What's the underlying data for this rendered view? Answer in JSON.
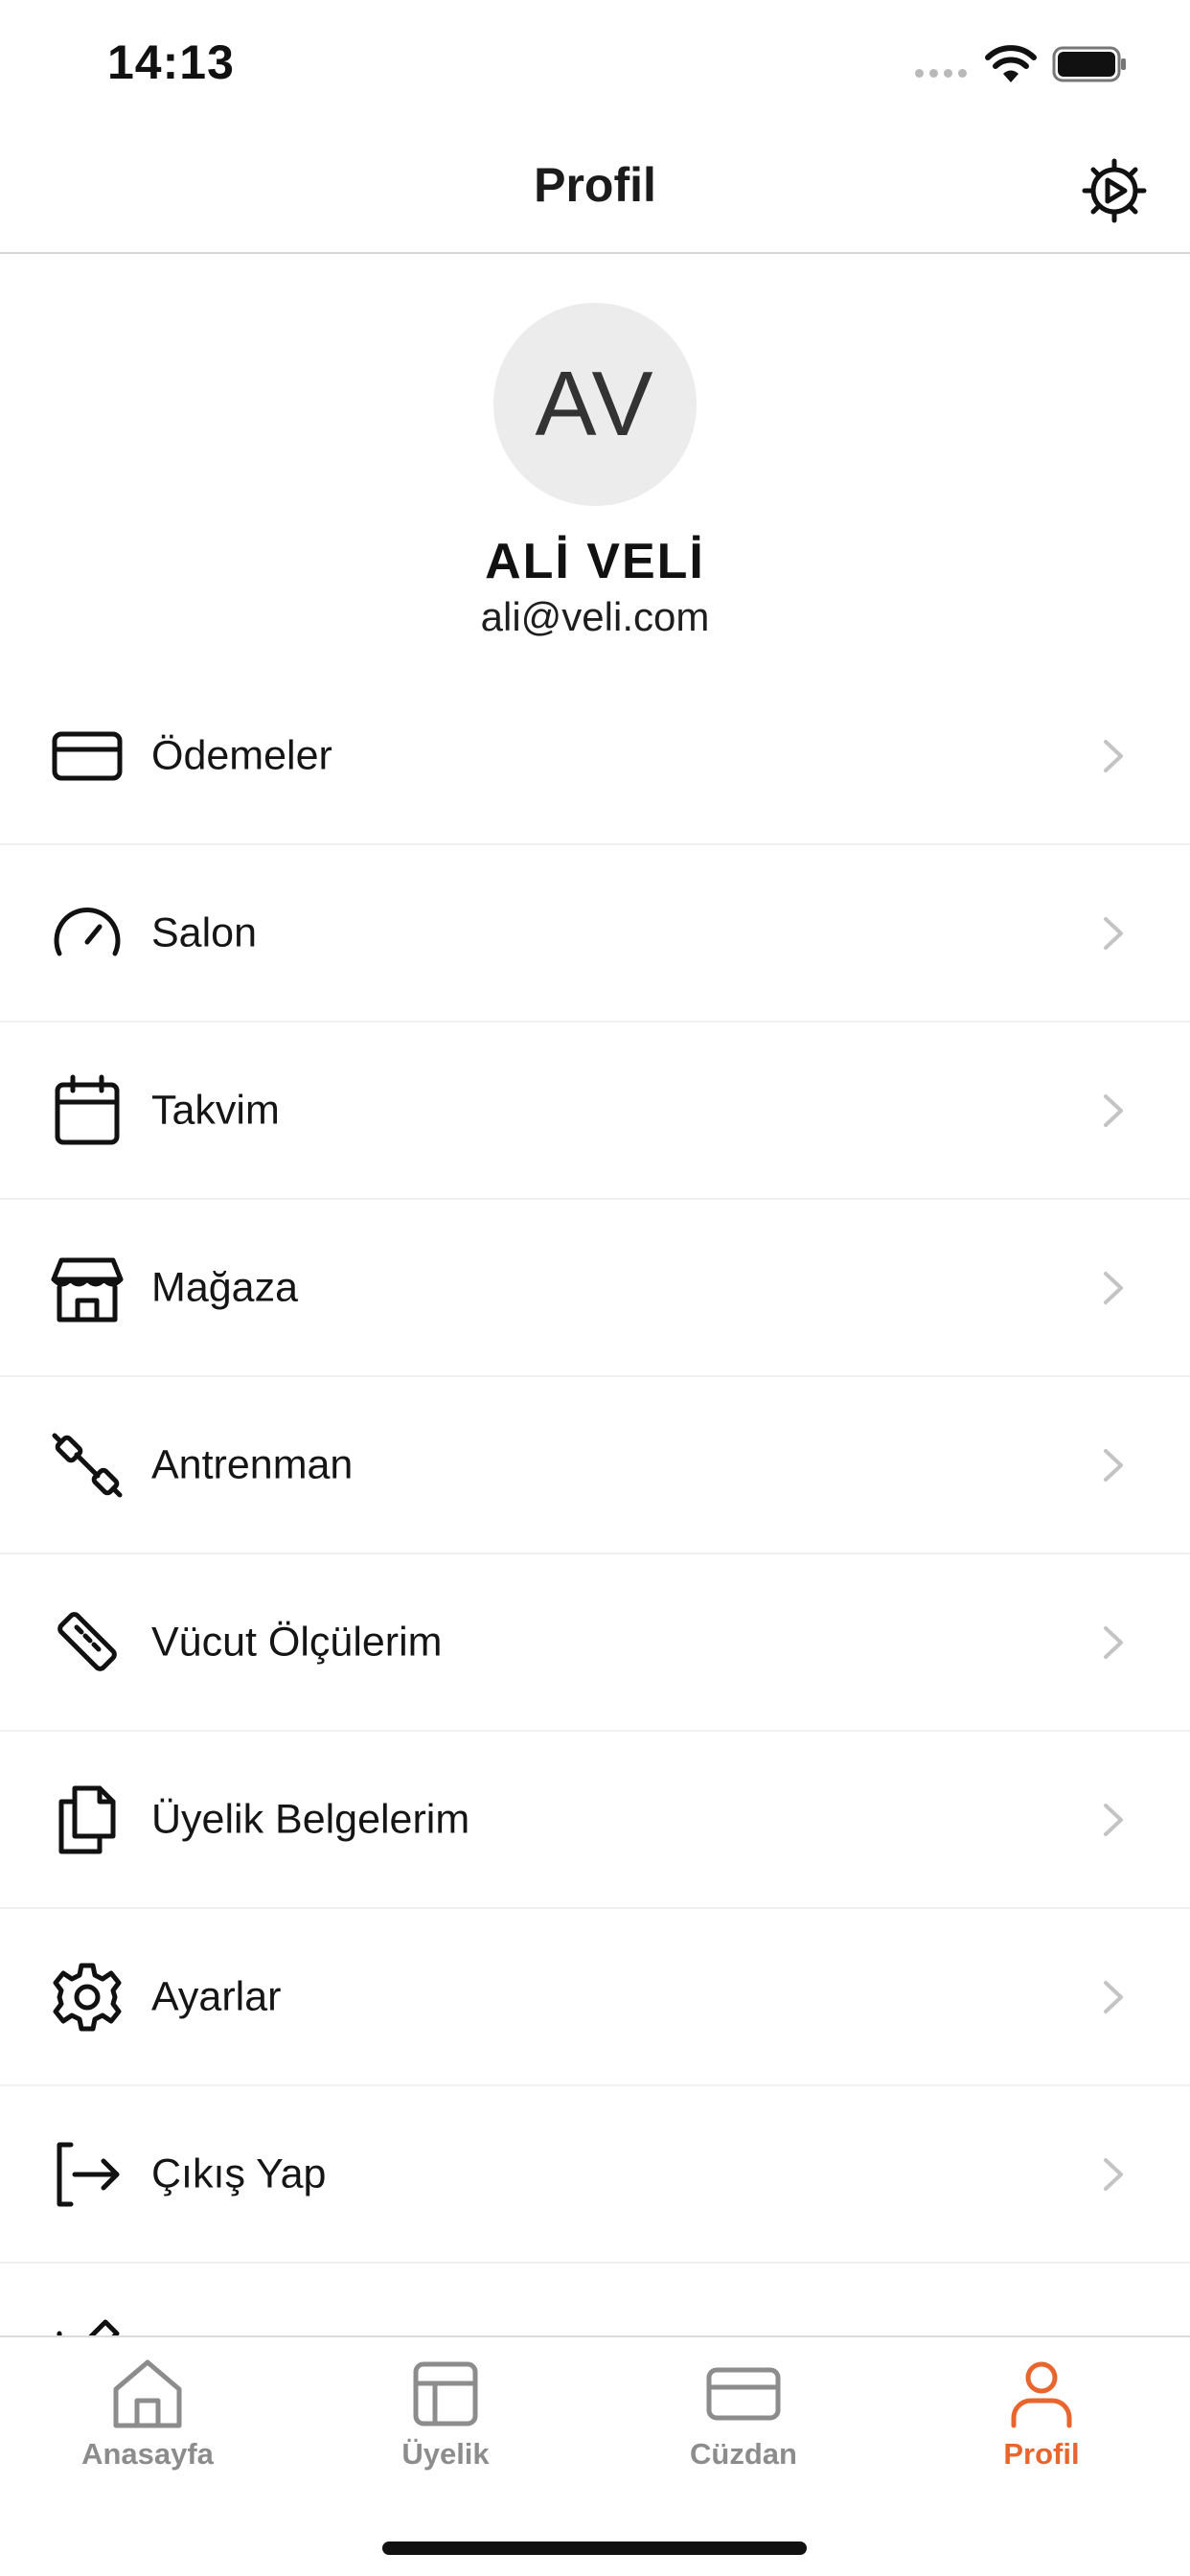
{
  "status_bar": {
    "time": "14:13"
  },
  "header": {
    "title": "Profil",
    "settings_icon": "gear-icon"
  },
  "profile": {
    "initials": "AV",
    "name": "ALİ VELİ",
    "email": "ali@veli.com"
  },
  "menu": {
    "items": [
      {
        "label": "Ödemeler",
        "icon": "credit-card-icon"
      },
      {
        "label": "Salon",
        "icon": "gauge-icon"
      },
      {
        "label": "Takvim",
        "icon": "calendar-icon"
      },
      {
        "label": "Mağaza",
        "icon": "store-icon"
      },
      {
        "label": "Antrenman",
        "icon": "dumbbell-icon"
      },
      {
        "label": "Vücut Ölçülerim",
        "icon": "ruler-icon"
      },
      {
        "label": "Üyelik Belgelerim",
        "icon": "documents-icon"
      },
      {
        "label": "Ayarlar",
        "icon": "gear-icon"
      },
      {
        "label": "Çıkış Yap",
        "icon": "logout-icon"
      }
    ]
  },
  "tab_bar": {
    "tabs": [
      {
        "label": "Anasayfa",
        "icon": "home-icon",
        "active": false
      },
      {
        "label": "Üyelik",
        "icon": "layout-icon",
        "active": false
      },
      {
        "label": "Cüzdan",
        "icon": "wallet-card-icon",
        "active": false
      },
      {
        "label": "Profil",
        "icon": "user-icon",
        "active": true
      }
    ]
  },
  "colors": {
    "accent": "#e8662e",
    "inactive_tab": "#8c8c8c",
    "avatar_bg": "#ececec"
  }
}
